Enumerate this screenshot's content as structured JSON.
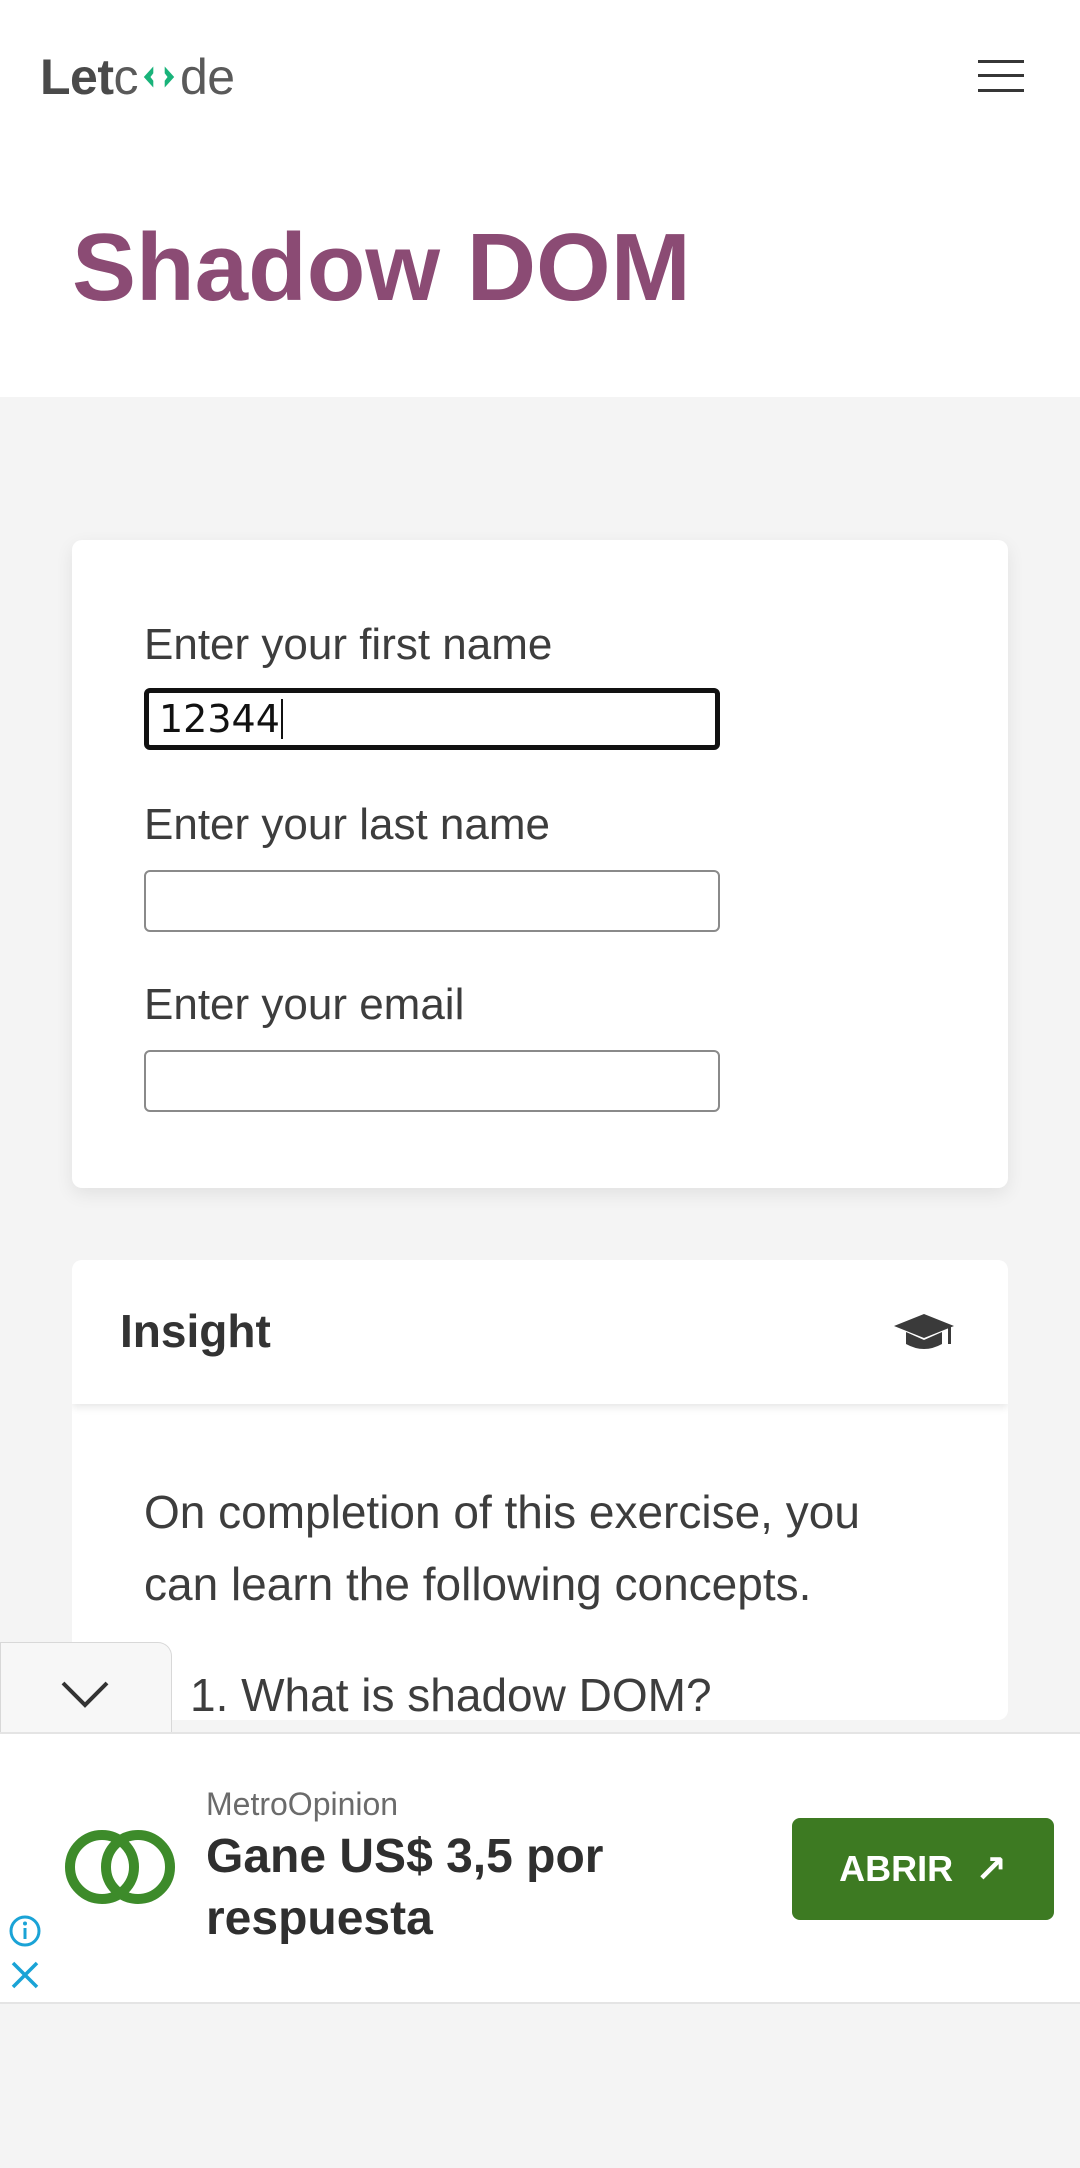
{
  "navbar": {
    "logo_left": "Let",
    "logo_right": "de",
    "menu_icon": "hamburger-menu-icon"
  },
  "hero": {
    "title": "Shadow DOM"
  },
  "form": {
    "first_name_label": "Enter your first name",
    "first_name_value": "12344",
    "last_name_label": "Enter your last name",
    "last_name_value": "",
    "email_label": "Enter your email",
    "email_value": ""
  },
  "insight": {
    "title": "Insight",
    "icon": "graduation-cap-icon",
    "description": "On completion of this exercise, you can learn the following concepts.",
    "items": [
      "1. What is shadow DOM?"
    ]
  },
  "collapse": {
    "icon": "chevron-down-icon"
  },
  "ad": {
    "brand": "MetroOpinion",
    "headline": "Gane US$ 3,5 por respuesta",
    "button_label": "ABRIR",
    "button_icon": "arrow-up-right-icon",
    "accent_color": "#3d7a22"
  },
  "colors": {
    "title": "#8b4b74",
    "section_bg": "#f4f4f4"
  }
}
